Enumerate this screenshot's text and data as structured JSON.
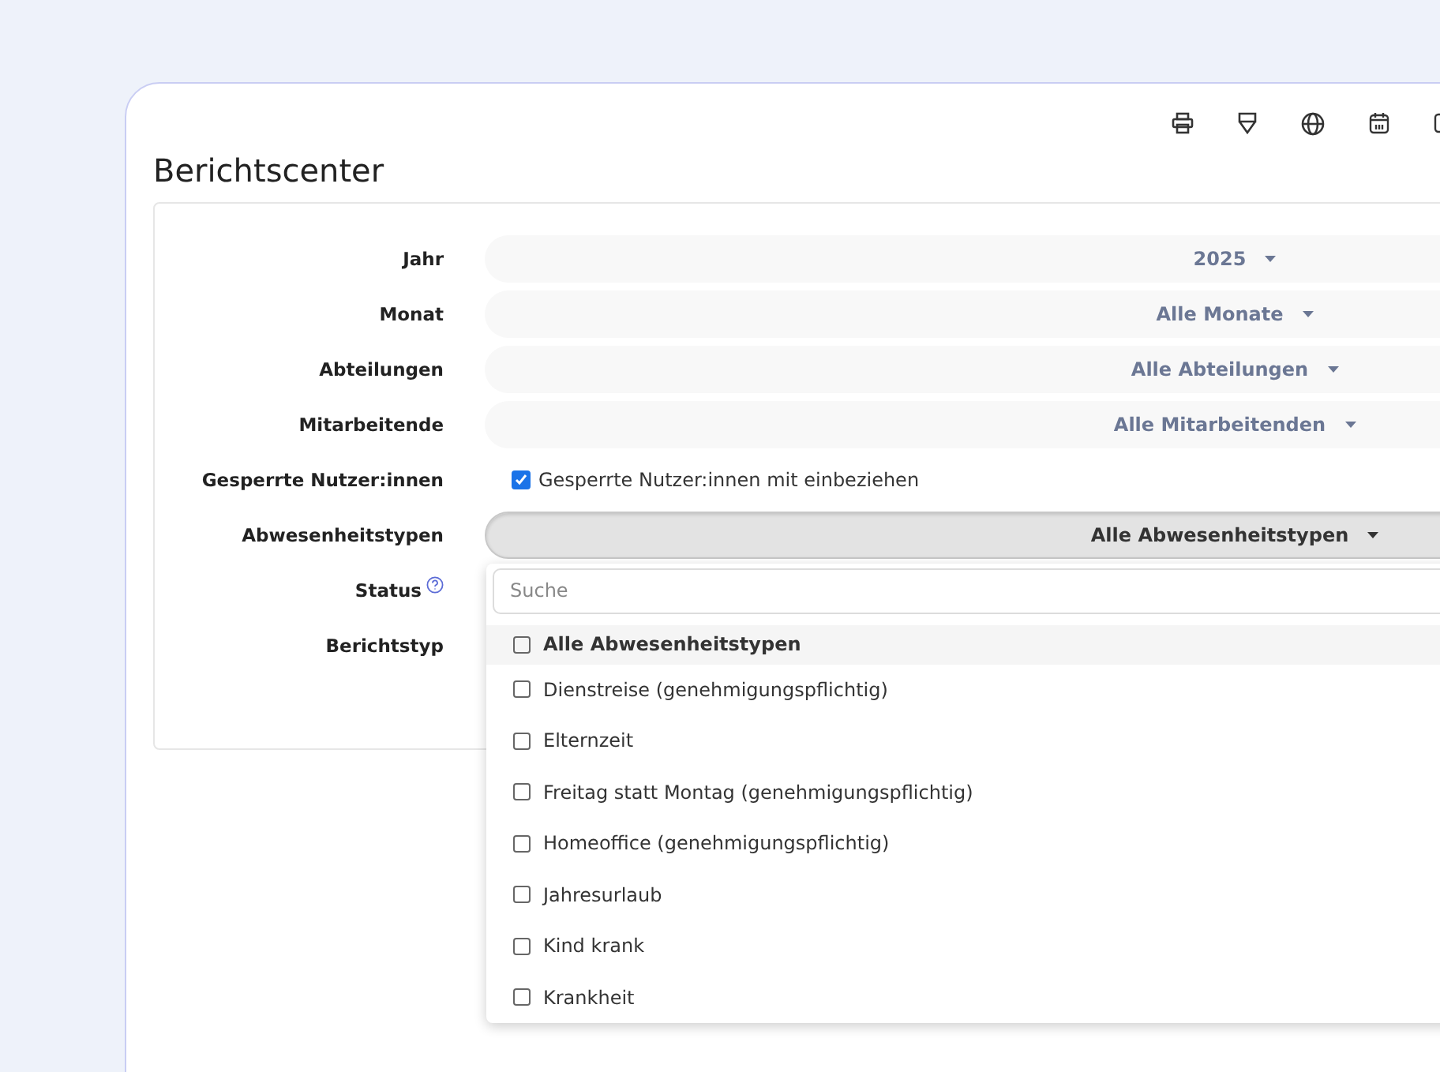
{
  "page_title": "Berichtscenter",
  "toolbar": [
    {
      "kind": "printer"
    },
    {
      "kind": "filter"
    },
    {
      "kind": "globe"
    },
    {
      "kind": "calendar"
    },
    {
      "kind": "square"
    }
  ],
  "fields": [
    {
      "label": "Jahr",
      "kind": "select",
      "value": "2025",
      "open": false
    },
    {
      "label": "Monat",
      "kind": "select",
      "value": "Alle Monate",
      "open": false
    },
    {
      "label": "Abteilungen",
      "kind": "select",
      "value": "Alle Abteilungen",
      "open": false
    },
    {
      "label": "Mitarbeitende",
      "kind": "select",
      "value": "Alle Mitarbeitenden",
      "open": false
    },
    {
      "label": "Gesperrte Nutzer:innen",
      "kind": "checkbox",
      "text": "Gesperrte Nutzer:innen mit einbeziehen",
      "checked": true
    },
    {
      "label": "Abwesenheitstypen",
      "kind": "select",
      "value": "Alle Abwesenheitstypen",
      "open": true
    },
    {
      "label": "Status",
      "kind": "help"
    },
    {
      "label": "Berichtstyp",
      "kind": "blank"
    }
  ],
  "dropdown": {
    "search_placeholder": "Suche",
    "options": [
      {
        "label": "Alle Abwesenheitstypen",
        "kind": "all",
        "checked": false,
        "selected": true
      },
      {
        "label": "Dienstreise (genehmigungspflichtig)",
        "kind": "item",
        "checked": false,
        "selected": false
      },
      {
        "label": "Elternzeit",
        "kind": "item",
        "checked": false,
        "selected": false
      },
      {
        "label": "Freitag statt Montag (genehmigungspflichtig)",
        "kind": "item",
        "checked": false,
        "selected": false
      },
      {
        "label": "Homeoffice (genehmigungspflichtig)",
        "kind": "item",
        "checked": false,
        "selected": false
      },
      {
        "label": "Jahresurlaub",
        "kind": "item",
        "checked": false,
        "selected": false
      },
      {
        "label": "Kind krank",
        "kind": "item",
        "checked": false,
        "selected": false
      },
      {
        "label": "Krankheit",
        "kind": "item",
        "checked": false,
        "selected": false
      }
    ]
  }
}
